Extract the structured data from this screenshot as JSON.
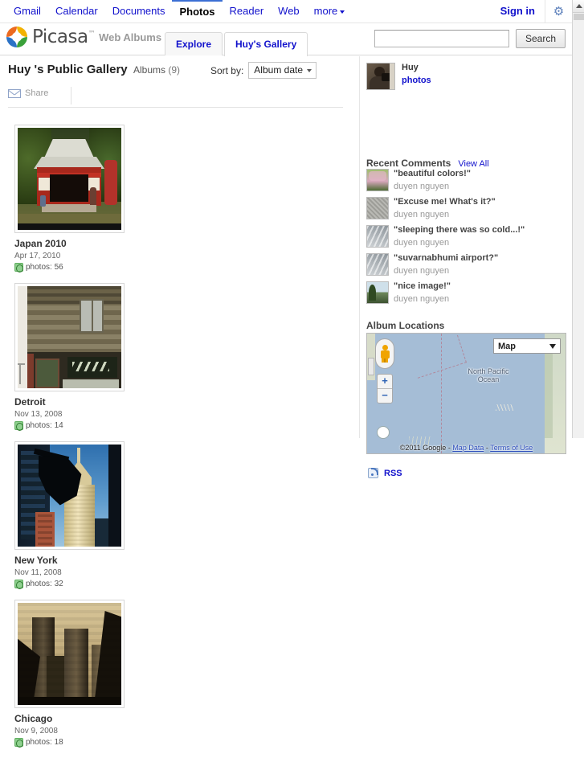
{
  "google_bar": {
    "links": [
      {
        "label": "Gmail",
        "active": false
      },
      {
        "label": "Calendar",
        "active": false
      },
      {
        "label": "Documents",
        "active": false
      },
      {
        "label": "Photos",
        "active": true
      },
      {
        "label": "Reader",
        "active": false
      },
      {
        "label": "Web",
        "active": false
      }
    ],
    "more_label": "more",
    "sign_in_label": "Sign in",
    "gear_icon": "gear-icon",
    "gear_glyph": "⚙"
  },
  "product_header": {
    "logo_text": "Picasa",
    "logo_tm": "™",
    "logo_subtitle": "Web Albums",
    "tabs": [
      {
        "label": "Explore",
        "selected": false
      },
      {
        "label": "Huy's Gallery",
        "selected": true
      }
    ],
    "search": {
      "value": "",
      "placeholder": "",
      "button_label": "Search"
    }
  },
  "gallery": {
    "title": "Huy 's Public Gallery",
    "subtitle": "Albums",
    "count": "(9)",
    "sort_label": "Sort by:",
    "sort_value": "Album date",
    "share_label": "Share"
  },
  "albums": [
    {
      "title": "Japan 2010",
      "date": "Apr 17, 2010",
      "photos": "photos: 56",
      "art": "jp"
    },
    {
      "title": "Detroit",
      "date": "Nov 13, 2008",
      "photos": "photos: 14",
      "art": "dt"
    },
    {
      "title": "New York",
      "date": "Nov 11, 2008",
      "photos": "photos: 32",
      "art": "ny"
    },
    {
      "title": "Chicago",
      "date": "Nov 9, 2008",
      "photos": "photos: 18",
      "art": "ch"
    }
  ],
  "sidebar": {
    "owner": {
      "name": "Huy",
      "link_label": "photos"
    },
    "comments_section": {
      "title": "Recent Comments",
      "view_all_label": "View All"
    },
    "comments": [
      {
        "text": "\"beautiful colors!\"",
        "user": "duyen nguyen",
        "thumb": "ct1"
      },
      {
        "text": "\"Excuse me! What's it?\"",
        "user": "duyen nguyen",
        "thumb": "ct2"
      },
      {
        "text": "\"sleeping there was so cold...!\"",
        "user": "duyen nguyen",
        "thumb": "ct3"
      },
      {
        "text": "\"suvarnabhumi airport?\"",
        "user": "duyen nguyen",
        "thumb": "ct5"
      },
      {
        "text": "\"nice image!\"",
        "user": "duyen nguyen",
        "thumb": "ct7"
      }
    ],
    "locations_section": {
      "title": "Album Locations"
    },
    "map": {
      "type_label": "Map",
      "ocean_label": "North Pacific\nOcean",
      "ocean_label_line1": "North Pacific",
      "ocean_label_line2": "Ocean",
      "copyright": "©2011 Google",
      "map_data_label": "Map Data",
      "terms_label": "Terms of Use",
      "zoom_in": "+",
      "zoom_out": "−",
      "pegman_icon": "pegman-icon"
    },
    "rss_label": "RSS"
  },
  "colors": {
    "link": "#1111cc",
    "accent_blue": "#3b6fd4",
    "map_ocean": "#a5bdd6",
    "globe_green": "#8fd08f"
  }
}
